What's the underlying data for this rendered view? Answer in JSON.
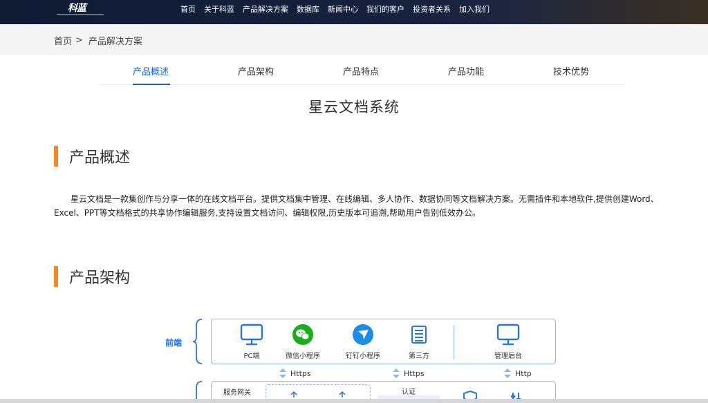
{
  "header": {
    "logo_text": "科蓝",
    "nav": [
      "首页",
      "关于科蓝",
      "产品解决方案",
      "数据库",
      "新闻中心",
      "我们的客户",
      "投资者关系",
      "加入我们"
    ]
  },
  "breadcrumb": {
    "home": "首页",
    "sep": ">",
    "current": "产品解决方案"
  },
  "tabs": [
    "产品概述",
    "产品架构",
    "产品特点",
    "产品功能",
    "技术优势"
  ],
  "page_title": "星云文档系统",
  "overview": {
    "heading": "产品概述",
    "text": "星云文档是一款集创作与分享一体的在线文档平台。提供文档集中管理、在线编辑、多人协作、数据协同等文档解决方案。无需插件和本地软件,提供创建Word、Excel、PPT等文档格式的共享协作编辑服务,支持设置文档访问、编辑权限,历史版本可追溯,帮助用户告别低效办公。"
  },
  "architecture": {
    "heading": "产品架构",
    "front_label": "前端",
    "front_items": [
      "PC端",
      "微信小程序",
      "钉钉小程序",
      "第三方",
      "管理后台"
    ],
    "protocols": [
      "Https",
      "Https",
      "Http"
    ],
    "gateway_label": "服务网关",
    "auth_label": "认证"
  },
  "colors": {
    "nav_bg": "#16213d",
    "accent": "#1d63c5",
    "section_bar": "#f5891f",
    "diagram_line": "#8db7ec",
    "wechat_green": "#1aad19"
  }
}
